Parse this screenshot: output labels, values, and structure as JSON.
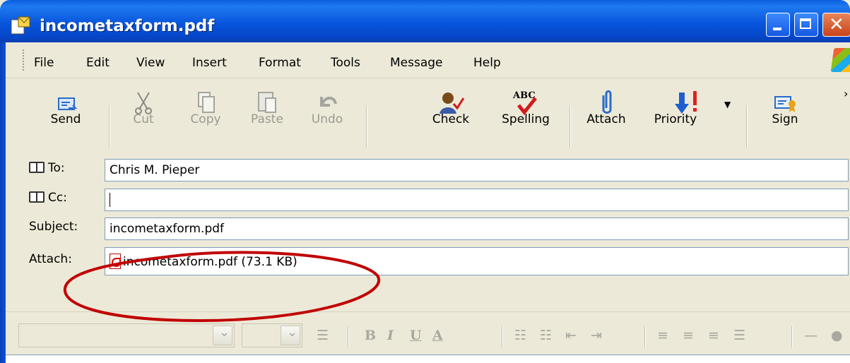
{
  "window": {
    "title": "incometaxform.pdf"
  },
  "menu": {
    "items": [
      "File",
      "Edit",
      "View",
      "Insert",
      "Format",
      "Tools",
      "Message",
      "Help"
    ]
  },
  "toolbar": {
    "buttons": [
      {
        "label": "Send",
        "icon": "send-icon",
        "enabled": true
      },
      {
        "label": "Cut",
        "icon": "scissors-icon",
        "enabled": false
      },
      {
        "label": "Copy",
        "icon": "copy-icon",
        "enabled": false
      },
      {
        "label": "Paste",
        "icon": "paste-icon",
        "enabled": false
      },
      {
        "label": "Undo",
        "icon": "undo-icon",
        "enabled": false
      },
      {
        "label": "Check",
        "icon": "check-names-icon",
        "enabled": true
      },
      {
        "label": "Spelling",
        "icon": "spelling-icon",
        "enabled": true,
        "icon_text": "ABC"
      },
      {
        "label": "Attach",
        "icon": "paperclip-icon",
        "enabled": true
      },
      {
        "label": "Priority",
        "icon": "priority-icon",
        "enabled": true
      },
      {
        "label": "Sign",
        "icon": "sign-icon",
        "enabled": true
      }
    ]
  },
  "headers": {
    "to_label": "To:",
    "to_value": "Chris M. Pieper",
    "cc_label": "Cc:",
    "cc_value": "",
    "subject_label": "Subject:",
    "subject_value": "incometaxform.pdf",
    "attach_label": "Attach:",
    "attachment": "incometaxform.pdf (73.1 KB)"
  },
  "format_toolbar": {
    "buttons": [
      "B",
      "I",
      "U",
      "A"
    ]
  },
  "colors": {
    "title_bar": "#0855dd",
    "window_bg": "#ece9d8",
    "annotation": "#c00000"
  }
}
